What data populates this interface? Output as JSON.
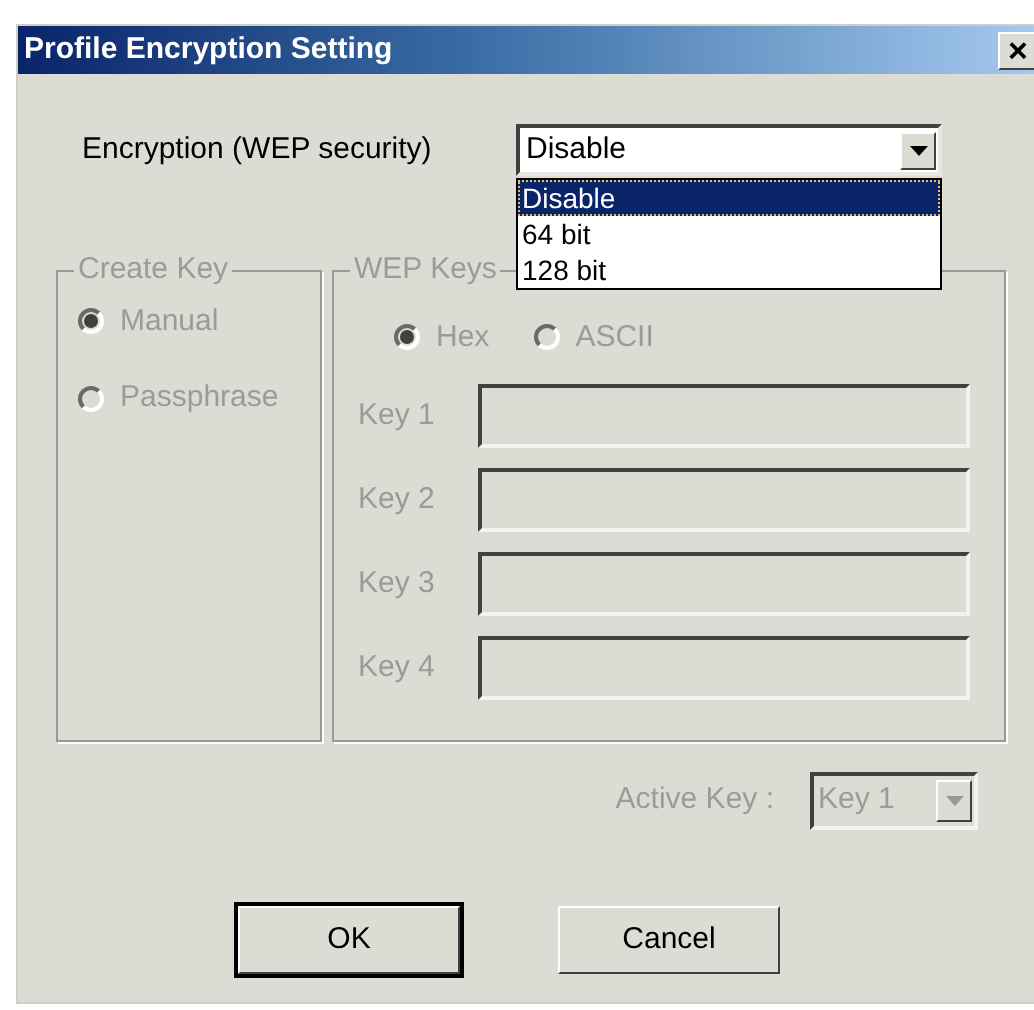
{
  "window": {
    "title": "Profile Encryption Setting",
    "close": "×"
  },
  "encryption": {
    "label": "Encryption (WEP security)",
    "value": "Disable",
    "options": [
      {
        "label": "Disable",
        "selected": true
      },
      {
        "label": "64 bit",
        "selected": false
      },
      {
        "label": "128 bit",
        "selected": false
      }
    ]
  },
  "create_key": {
    "title": "Create Key",
    "disabled": true,
    "options": [
      {
        "label": "Manual",
        "selected": true
      },
      {
        "label": "Passphrase",
        "selected": false
      }
    ]
  },
  "wep_keys": {
    "title": "WEP Keys",
    "disabled": true,
    "formats": [
      {
        "label": "Hex",
        "selected": true
      },
      {
        "label": "ASCII",
        "selected": false
      }
    ],
    "keys": [
      {
        "label": "Key 1"
      },
      {
        "label": "Key 2"
      },
      {
        "label": "Key 3"
      },
      {
        "label": "Key 4"
      }
    ]
  },
  "active_key": {
    "label": "Active Key :",
    "value": "Key 1",
    "disabled": true
  },
  "buttons": [
    {
      "label": "OK",
      "default": true
    },
    {
      "label": "Cancel",
      "default": false
    }
  ]
}
